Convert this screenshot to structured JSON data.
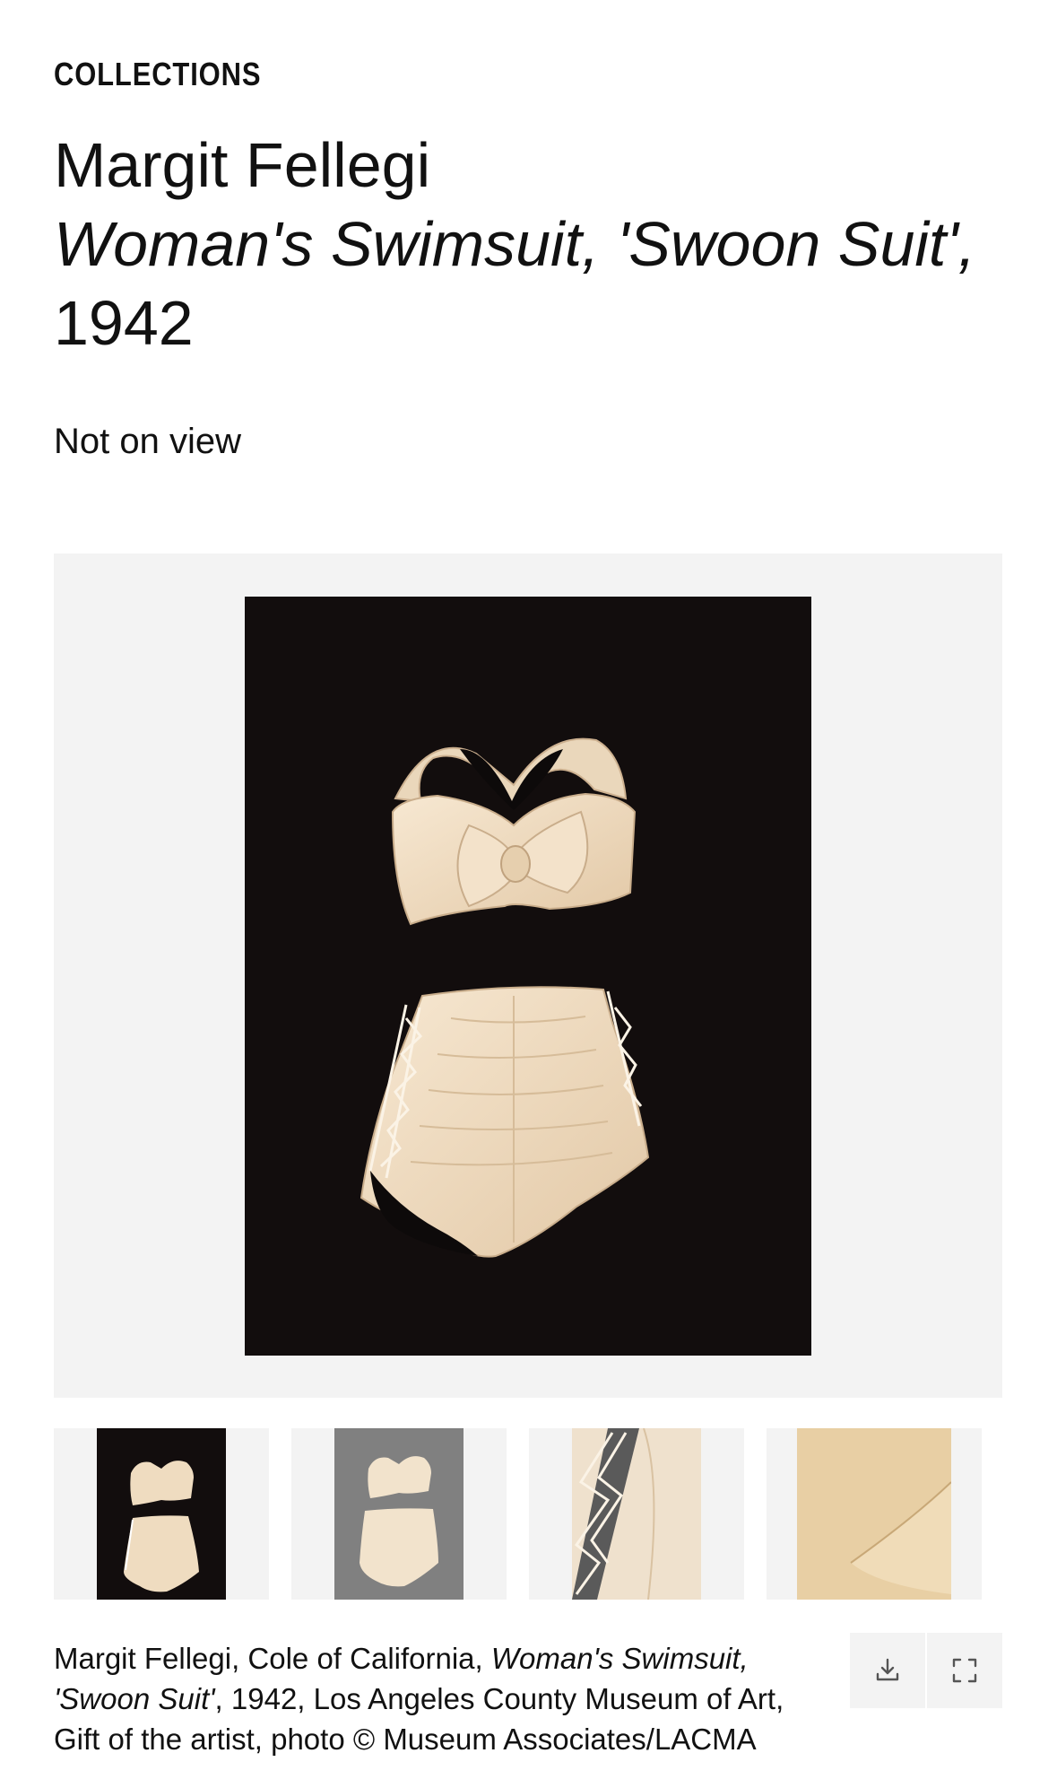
{
  "header": {
    "section_label": "COLLECTIONS",
    "artist": "Margit Fellegi",
    "title": "Woman's Swimsuit, 'Swoon Suit',",
    "year": "1942",
    "status": "Not on view"
  },
  "main_image": {
    "alt": "Woman's Swimsuit, 'Swoon Suit', two-piece cream swimsuit on black background",
    "background": "#120d0d",
    "garment_color": "#f0dcc0"
  },
  "thumbnails": [
    {
      "label": "full view on black",
      "background": "#120d0d"
    },
    {
      "label": "full view on grey",
      "background": "#808080"
    },
    {
      "label": "side lacing detail",
      "background": "#efe1cd"
    },
    {
      "label": "fabric bow detail",
      "background": "#e8cfa4"
    }
  ],
  "caption": {
    "part1": "Margit Fellegi, Cole of California, ",
    "title_italic_1": "Woman's Swimsuit,",
    "title_italic_2": "'Swoon Suit'",
    "part2": ", 1942, Los Angeles County Museum of Art,",
    "part3": "Gift of the artist, photo © Museum Associates/LACMA"
  },
  "actions": {
    "download_icon": "download-icon",
    "fullscreen_icon": "fullscreen-icon"
  }
}
